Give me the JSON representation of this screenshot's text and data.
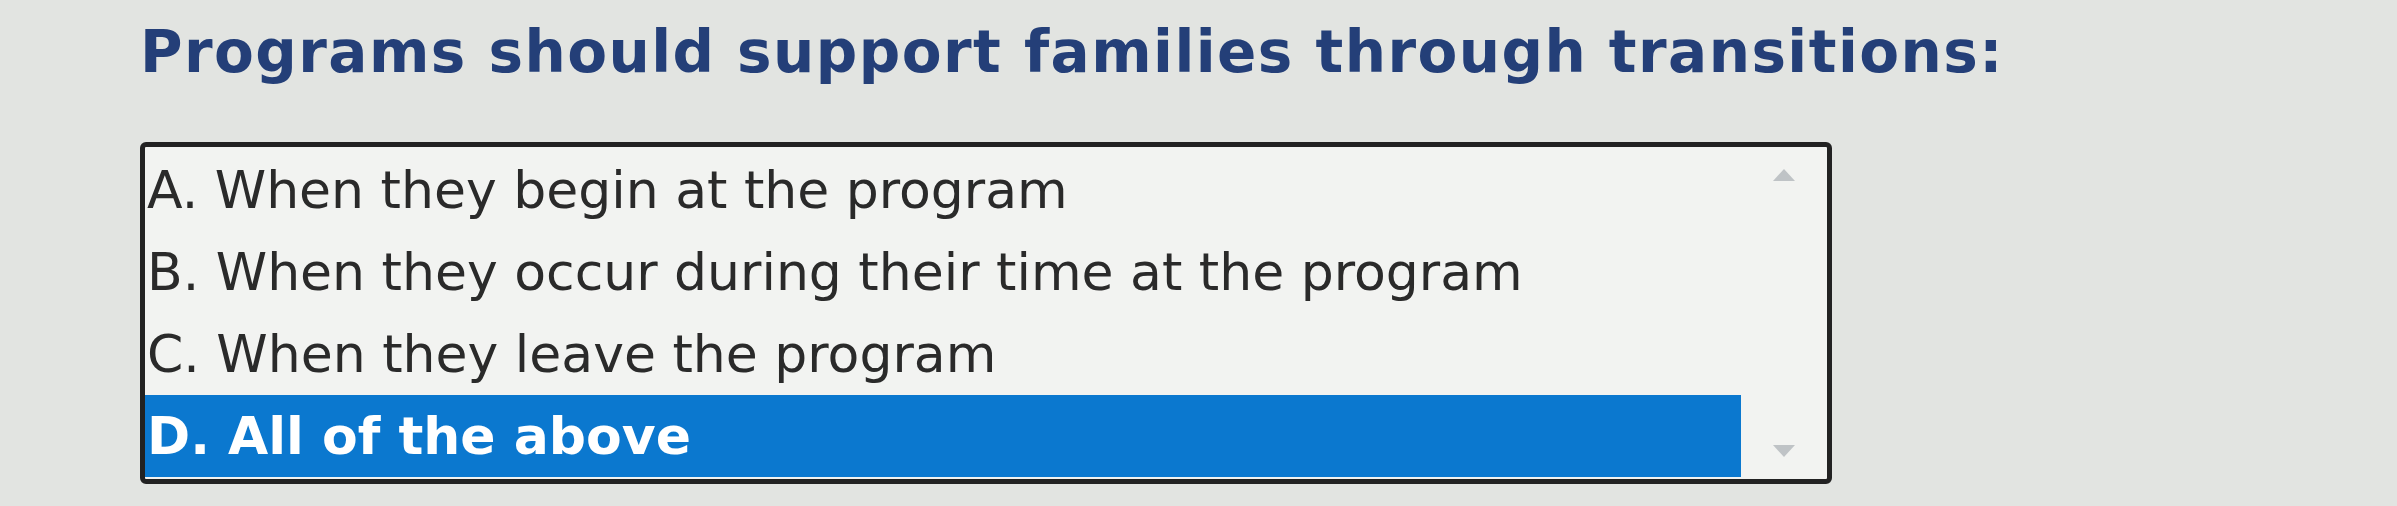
{
  "question": {
    "title": "Programs should support families through transitions:"
  },
  "listbox": {
    "options": [
      {
        "label": "A. When they begin at the program",
        "selected": false
      },
      {
        "label": "B. When they occur during their time at the program",
        "selected": false
      },
      {
        "label": "C. When they leave the program",
        "selected": false
      },
      {
        "label": "D. All of the above",
        "selected": true
      }
    ]
  }
}
